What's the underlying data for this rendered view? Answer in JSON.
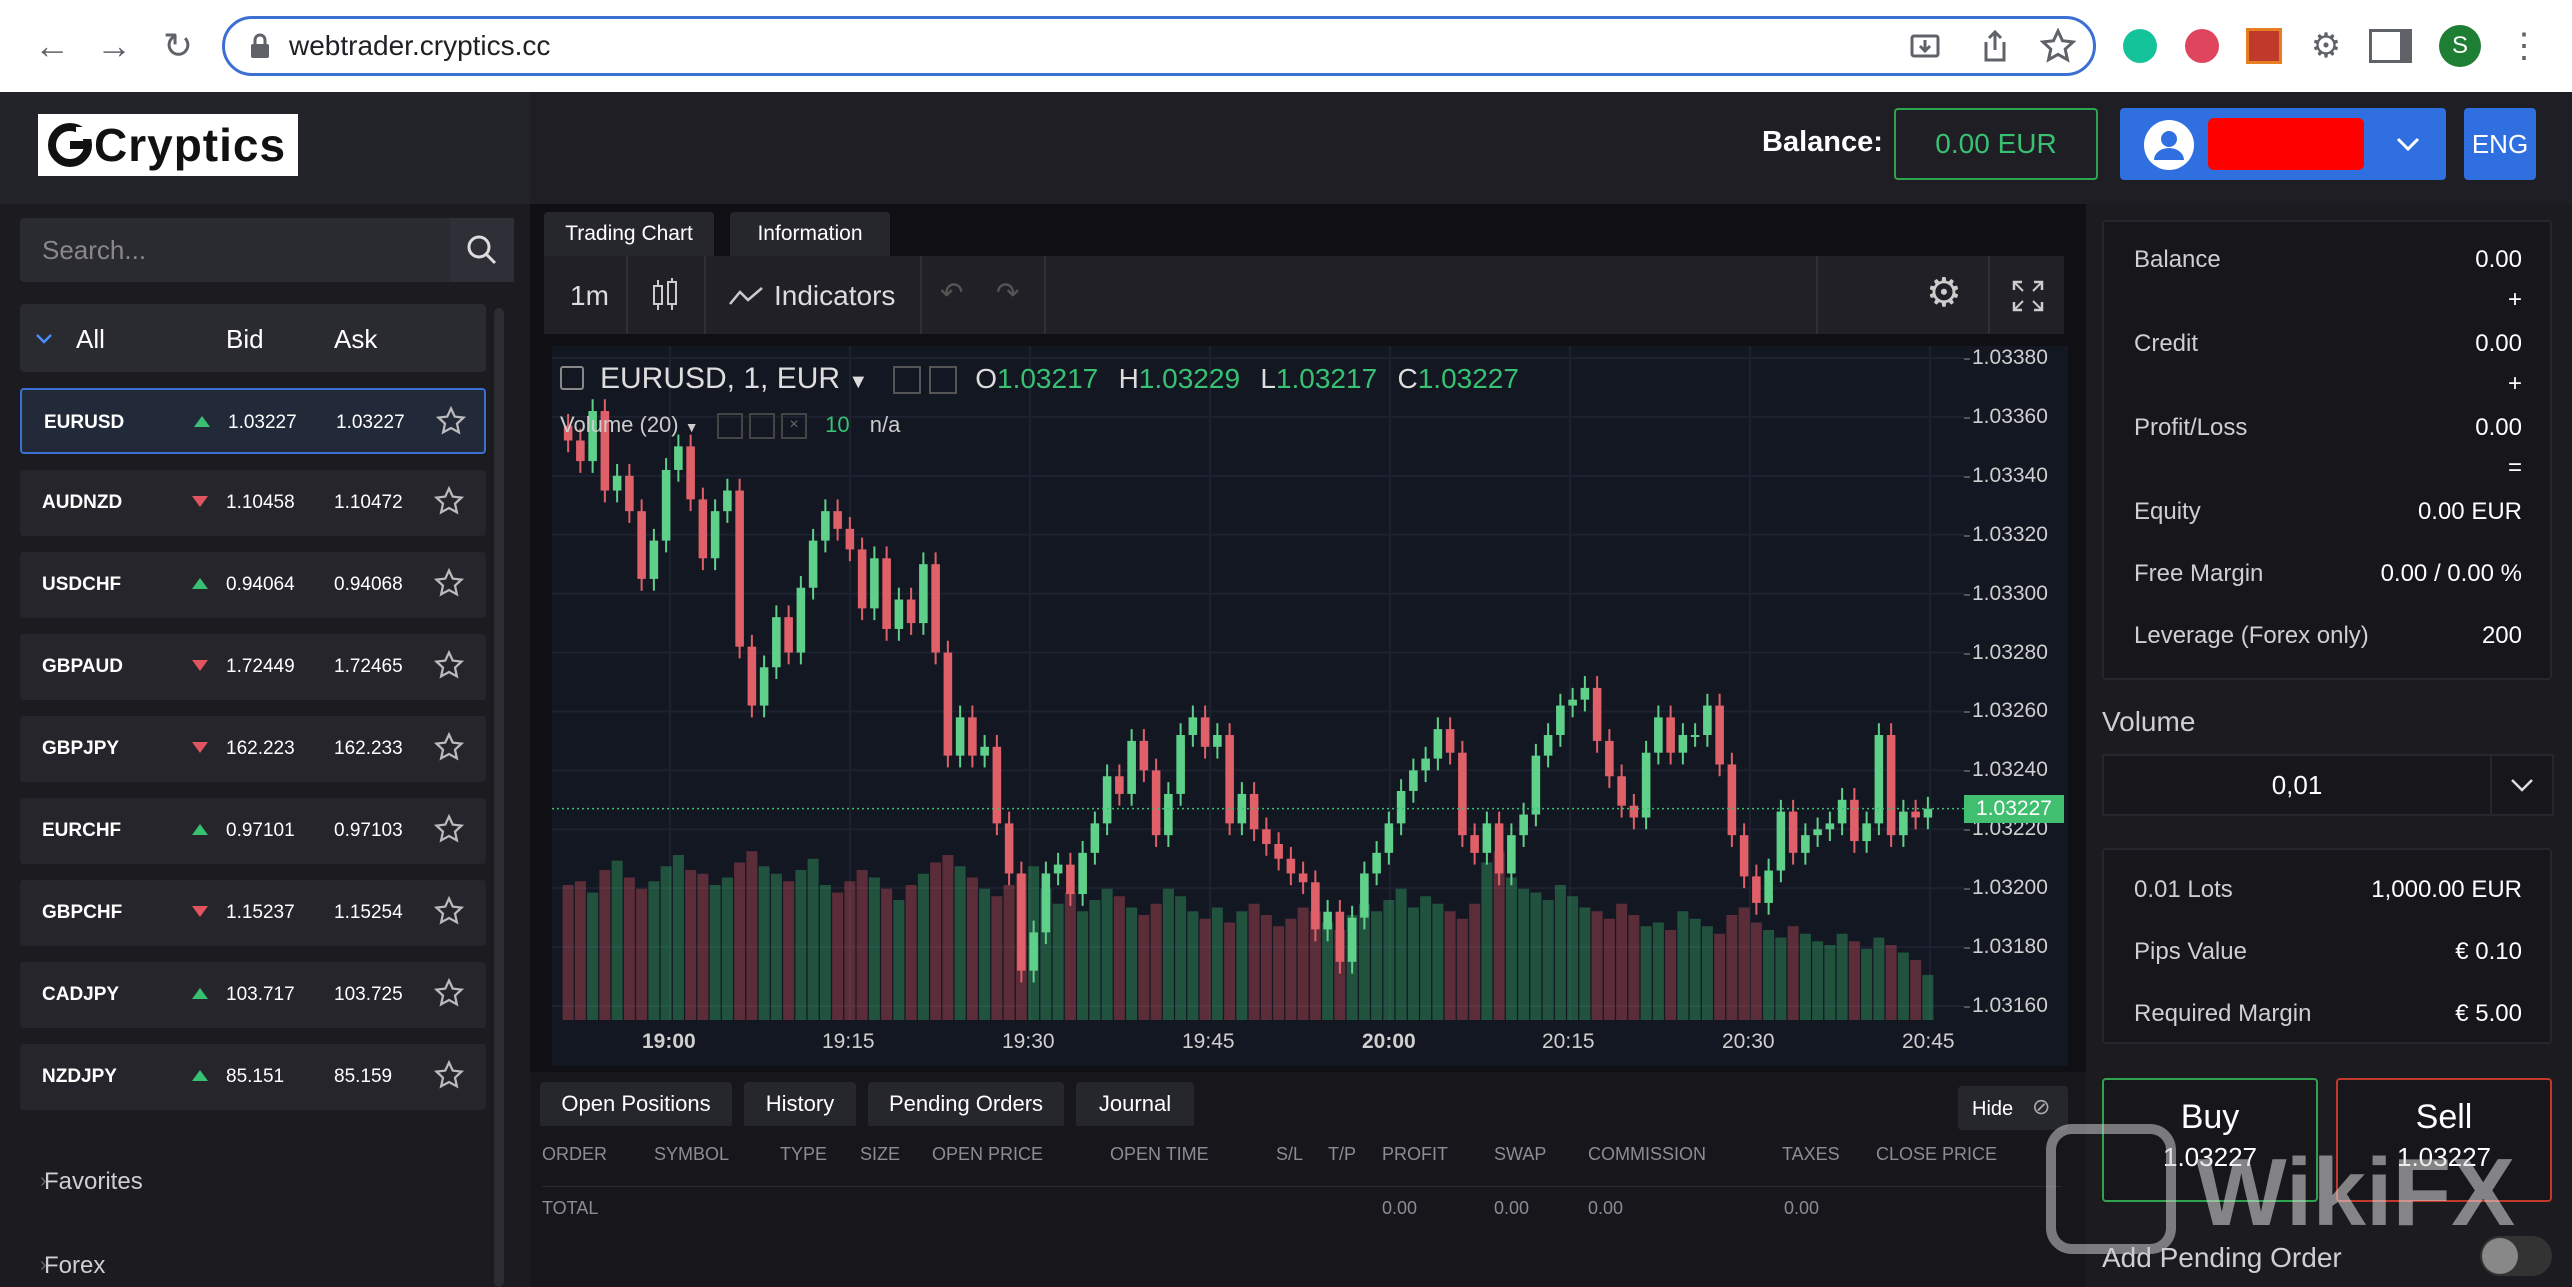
{
  "browser": {
    "url": "webtrader.cryptics.cc",
    "profile_initial": "S"
  },
  "header": {
    "logo_text": "Cryptics",
    "balance_label": "Balance:",
    "balance_value": "0.00 EUR",
    "language": "ENG"
  },
  "sidebar": {
    "search_placeholder": "Search...",
    "columns": {
      "all": "All",
      "bid": "Bid",
      "ask": "Ask"
    },
    "instruments": [
      {
        "symbol": "EURUSD",
        "dir": "up",
        "bid": "1.03227",
        "ask": "1.03227"
      },
      {
        "symbol": "AUDNZD",
        "dir": "down",
        "bid": "1.10458",
        "ask": "1.10472"
      },
      {
        "symbol": "USDCHF",
        "dir": "up",
        "bid": "0.94064",
        "ask": "0.94068"
      },
      {
        "symbol": "GBPAUD",
        "dir": "down",
        "bid": "1.72449",
        "ask": "1.72465"
      },
      {
        "symbol": "GBPJPY",
        "dir": "down",
        "bid": "162.223",
        "ask": "162.233"
      },
      {
        "symbol": "EURCHF",
        "dir": "up",
        "bid": "0.97101",
        "ask": "0.97103"
      },
      {
        "symbol": "GBPCHF",
        "dir": "down",
        "bid": "1.15237",
        "ask": "1.15254"
      },
      {
        "symbol": "CADJPY",
        "dir": "up",
        "bid": "103.717",
        "ask": "103.725"
      },
      {
        "symbol": "NZDJPY",
        "dir": "up",
        "bid": "85.151",
        "ask": "85.159"
      }
    ],
    "categories": [
      "Favorites",
      "Forex"
    ]
  },
  "chart_tabs": [
    "Trading Chart",
    "Information"
  ],
  "toolbar": {
    "interval": "1m",
    "indicators": "Indicators"
  },
  "chart_legend": {
    "symbol": "EURUSD, 1, EUR",
    "o_label": "O",
    "o": "1.03217",
    "h_label": "H",
    "h": "1.03229",
    "l_label": "L",
    "l": "1.03217",
    "c_label": "C",
    "c": "1.03227",
    "volume_label": "Volume (20)",
    "volume_value": "10",
    "volume_na": "n/a"
  },
  "chart_data": {
    "type": "candlestick",
    "symbol": "EURUSD",
    "y_ticks": [
      "1.03380",
      "1.03360",
      "1.03340",
      "1.03320",
      "1.03300",
      "1.03280",
      "1.03260",
      "1.03240",
      "1.03220",
      "1.03200",
      "1.03180",
      "1.03160"
    ],
    "ylim": [
      1.0316,
      1.0338
    ],
    "current_price": "1.03227",
    "x_ticks": [
      "19:00",
      "19:15",
      "19:30",
      "19:45",
      "20:00",
      "20:15",
      "20:30",
      "20:45"
    ],
    "x_ticks_bold": [
      "19:00",
      "20:00"
    ],
    "candles_close": [
      1.03352,
      1.03345,
      1.03362,
      1.03335,
      1.0334,
      1.03328,
      1.03305,
      1.03318,
      1.03342,
      1.0335,
      1.03332,
      1.03312,
      1.03328,
      1.03335,
      1.03282,
      1.03262,
      1.03275,
      1.03292,
      1.0328,
      1.03302,
      1.03318,
      1.03328,
      1.03322,
      1.03315,
      1.03295,
      1.03312,
      1.03288,
      1.03298,
      1.0329,
      1.0331,
      1.0328,
      1.03245,
      1.03258,
      1.03245,
      1.03248,
      1.03222,
      1.03205,
      1.03172,
      1.03185,
      1.03205,
      1.03208,
      1.03198,
      1.03212,
      1.03222,
      1.03238,
      1.03232,
      1.0325,
      1.0324,
      1.03218,
      1.03232,
      1.03252,
      1.03258,
      1.03248,
      1.03252,
      1.03222,
      1.03232,
      1.0322,
      1.03215,
      1.0321,
      1.03205,
      1.03202,
      1.03186,
      1.03192,
      1.03175,
      1.0319,
      1.03205,
      1.03212,
      1.03222,
      1.03233,
      1.0324,
      1.03244,
      1.03254,
      1.03246,
      1.03218,
      1.03212,
      1.03222,
      1.03205,
      1.03218,
      1.03225,
      1.03245,
      1.03252,
      1.03262,
      1.03264,
      1.03268,
      1.0325,
      1.03238,
      1.03228,
      1.03224,
      1.03246,
      1.03258,
      1.03246,
      1.03252,
      1.03252,
      1.03262,
      1.03242,
      1.03218,
      1.03204,
      1.03195,
      1.03206,
      1.03226,
      1.03212,
      1.03218,
      1.0322,
      1.03222,
      1.0323,
      1.03216,
      1.03222,
      1.03252,
      1.03218,
      1.03226,
      1.03224,
      1.03227
    ],
    "volume": [
      72,
      74,
      68,
      80,
      85,
      76,
      70,
      74,
      82,
      88,
      80,
      78,
      72,
      76,
      84,
      90,
      82,
      78,
      74,
      80,
      86,
      72,
      68,
      74,
      80,
      76,
      70,
      64,
      72,
      78,
      84,
      88,
      82,
      76,
      70,
      66,
      72,
      78,
      82,
      70,
      62,
      68,
      58,
      64,
      70,
      66,
      60,
      56,
      62,
      70,
      66,
      58,
      54,
      60,
      52,
      58,
      62,
      56,
      50,
      54,
      60,
      58,
      52,
      48,
      56,
      62,
      58,
      64,
      70,
      60,
      66,
      62,
      58,
      54,
      62,
      84,
      90,
      76,
      70,
      68,
      64,
      72,
      66,
      60,
      58,
      54,
      62,
      56,
      50,
      52,
      48,
      58,
      54,
      50,
      46,
      56,
      60,
      52,
      48,
      44,
      50,
      46,
      42,
      40,
      46,
      42,
      38,
      44,
      40,
      36,
      32,
      24
    ]
  },
  "positions": {
    "tabs": [
      "Open Positions",
      "History",
      "Pending Orders",
      "Journal"
    ],
    "hide_label": "Hide",
    "columns": [
      "ORDER",
      "SYMBOL",
      "TYPE",
      "SIZE",
      "OPEN PRICE",
      "OPEN TIME",
      "S/L",
      "T/P",
      "PROFIT",
      "SWAP",
      "COMMISSION",
      "TAXES",
      "CLOSE PRICE"
    ],
    "total_label": "TOTAL",
    "totals": {
      "profit": "0.00",
      "swap": "0.00",
      "commission": "0.00",
      "taxes": "0.00"
    }
  },
  "account": {
    "balance_label": "Balance",
    "balance": "0.00",
    "credit_label": "Credit",
    "credit": "0.00",
    "pl_label": "Profit/Loss",
    "pl": "0.00",
    "equity_label": "Equity",
    "equity": "0.00 EUR",
    "free_margin_label": "Free Margin",
    "free_margin": "0.00 / 0.00 %",
    "leverage_label": "Leverage (Forex only)",
    "leverage": "200",
    "plus": "+",
    "equals": "="
  },
  "order": {
    "volume_label": "Volume",
    "volume_value": "0,01",
    "lots_label": "0.01 Lots",
    "lots_value": "1,000.00 EUR",
    "pips_label": "Pips Value",
    "pips_value": "€ 0.10",
    "margin_label": "Required Margin",
    "margin_value": "€ 5.00",
    "buy_label": "Buy",
    "buy_price": "1.03227",
    "sell_label": "Sell",
    "sell_price": "1.03227",
    "pending_label": "Add Pending Order"
  },
  "watermark": "WikiFX",
  "colors": {
    "up": "#38c172",
    "down": "#e05560",
    "accent": "#2f6fe0"
  }
}
